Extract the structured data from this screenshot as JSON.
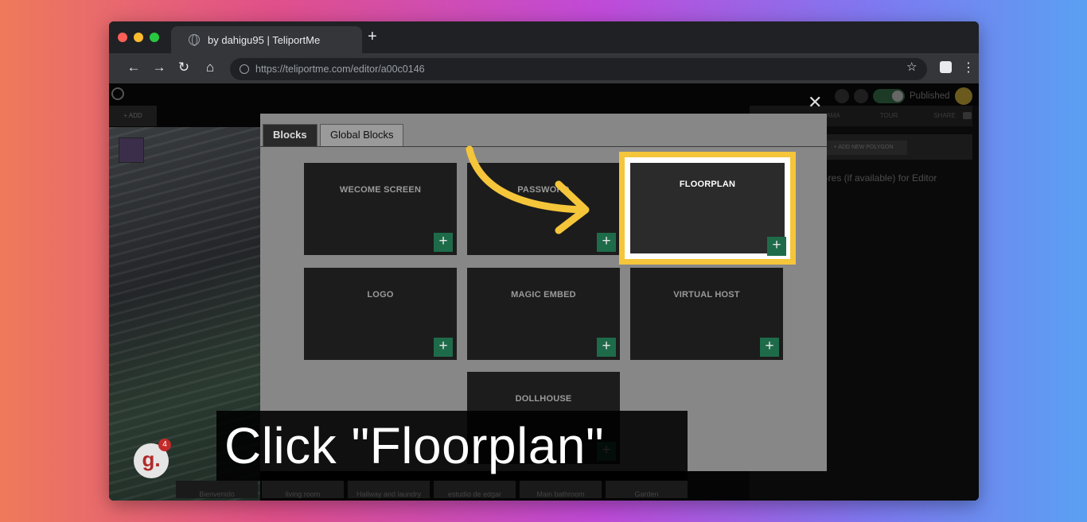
{
  "browser": {
    "tab_title": "by dahigu95 | TeliportMe",
    "new_tab_symbol": "+",
    "url": "https://teliportme.com/editor/a00c0146",
    "nav": {
      "back": "←",
      "forward": "→",
      "reload": "↻",
      "home": "⌂",
      "star": "☆",
      "menu": "⋮"
    }
  },
  "editor": {
    "published_label": "Published",
    "right_tabs": [
      "",
      "AMA",
      "TOUR",
      "SHARE"
    ],
    "add_polygon_label": "+ ADD NEW POLYGON",
    "hint_text": "w-res (if available) for Editor",
    "add_label": "+ ADD",
    "scene_thumbs": [
      "Bienvenido",
      "living room",
      "Hallway and laundry",
      "estudio de edgar",
      "Main bathroom",
      "Garden"
    ]
  },
  "modal": {
    "tabs": {
      "active": "Blocks",
      "inactive": "Global Blocks"
    },
    "close_symbol": "✕",
    "add_symbol": "+",
    "cards": [
      {
        "label": "WECOME SCREEN"
      },
      {
        "label": "PASSWORD"
      },
      {
        "label": "FLOORPLAN"
      },
      {
        "label": "LOGO"
      },
      {
        "label": "MAGIC EMBED"
      },
      {
        "label": "VIRTUAL HOST"
      },
      {
        "label": "DOLLHOUSE"
      }
    ]
  },
  "overlay": {
    "caption": "Click \"Floorplan\"",
    "logo_letter": "g.",
    "badge_count": "4",
    "arrow_color": "#f5c53a"
  }
}
